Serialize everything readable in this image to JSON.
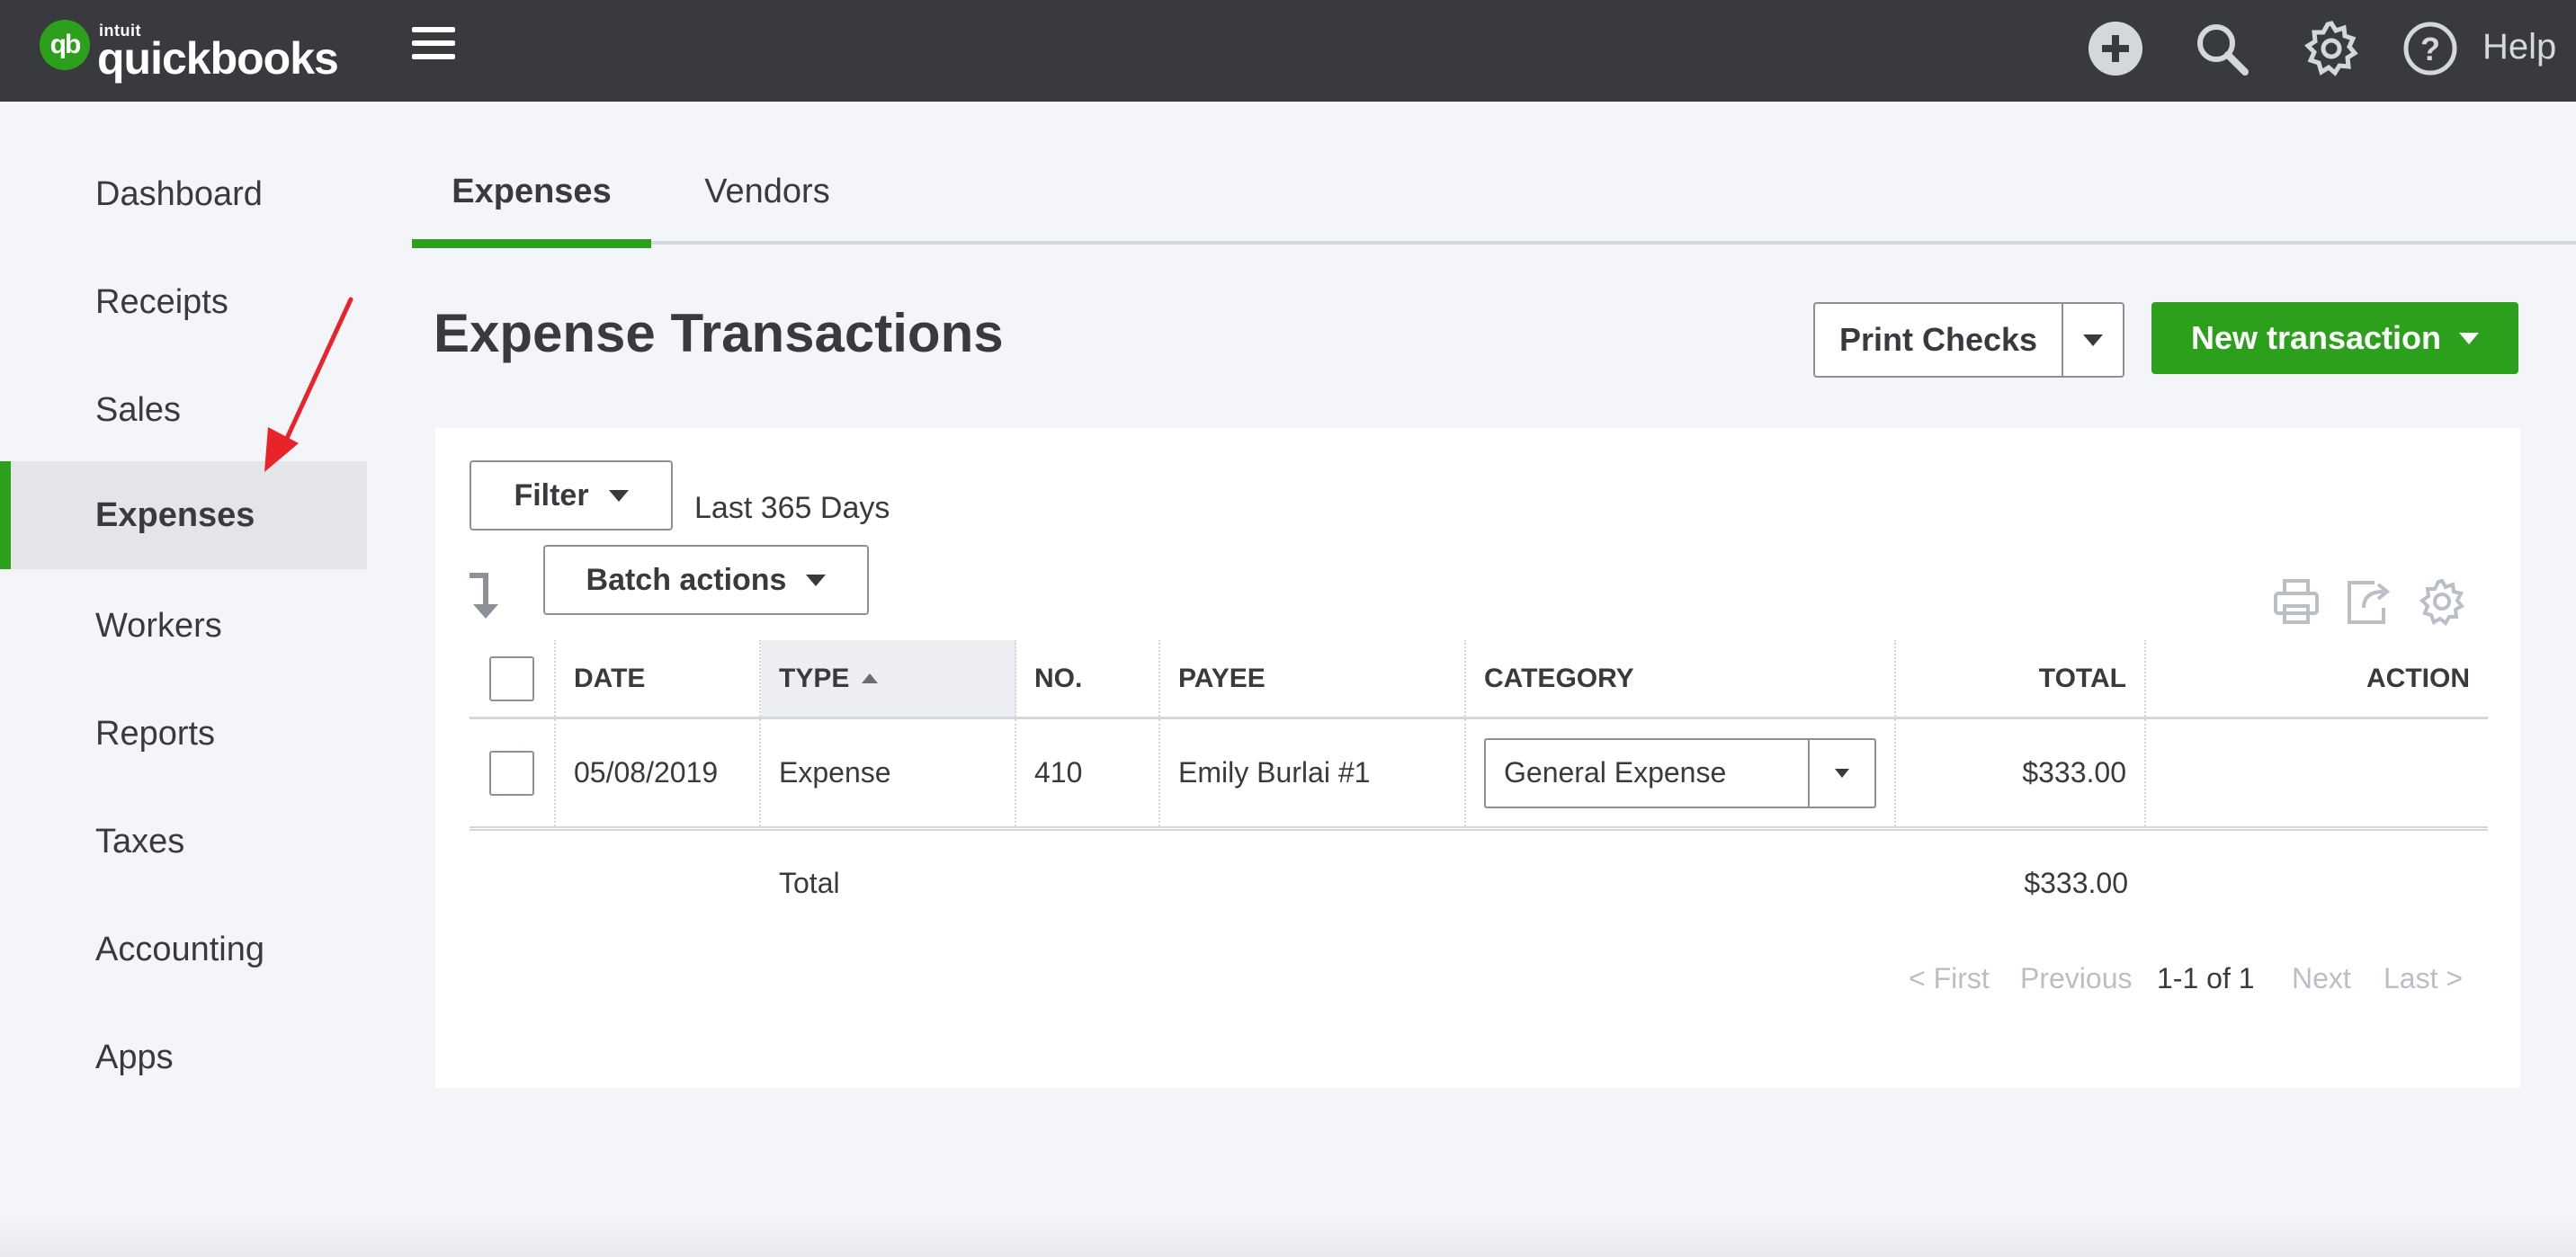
{
  "brand": {
    "mark": "qb",
    "intuit": "intuit",
    "name": "quickbooks"
  },
  "topbar": {
    "icons": [
      "hamburger-icon",
      "plus-icon",
      "search-icon",
      "gear-icon",
      "help-icon"
    ],
    "help_label": "Help"
  },
  "sidebar": {
    "items": [
      {
        "label": "Dashboard"
      },
      {
        "label": "Receipts"
      },
      {
        "label": "Sales"
      },
      {
        "label": "Expenses",
        "active": true
      },
      {
        "label": "Workers"
      },
      {
        "label": "Reports"
      },
      {
        "label": "Taxes"
      },
      {
        "label": "Accounting"
      },
      {
        "label": "Apps"
      }
    ]
  },
  "tabs": [
    {
      "label": "Expenses",
      "active": true
    },
    {
      "label": "Vendors"
    }
  ],
  "page": {
    "title": "Expense Transactions",
    "print_checks_label": "Print Checks",
    "new_transaction_label": "New transaction"
  },
  "toolbar": {
    "filter_label": "Filter",
    "date_range": "Last 365 Days",
    "batch_label": "Batch actions",
    "icons": [
      "print-icon",
      "export-icon",
      "settings-icon"
    ]
  },
  "table": {
    "columns": [
      "DATE",
      "TYPE",
      "NO.",
      "PAYEE",
      "CATEGORY",
      "TOTAL",
      "ACTION"
    ],
    "sorted_column": "TYPE",
    "rows": [
      {
        "date": "05/08/2019",
        "type": "Expense",
        "no": "410",
        "payee": "Emily Burlai #1",
        "category": "General Expense",
        "total": "$333.00",
        "action": ""
      }
    ],
    "total_label": "Total",
    "total_value": "$333.00"
  },
  "pagination": {
    "first": "< First",
    "previous": "Previous",
    "range": "1-1 of 1",
    "next": "Next",
    "last": "Last >"
  },
  "colors": {
    "topbar": "#393a3d",
    "accent_green": "#2ca01c",
    "annotation_red": "#e8242a",
    "page_bg": "#f4f5f8"
  }
}
